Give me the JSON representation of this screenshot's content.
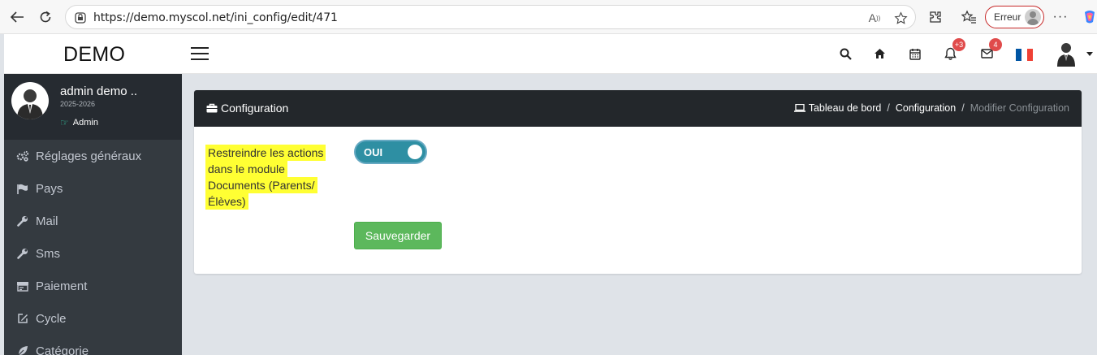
{
  "browser": {
    "url": "https://demo.myscol.net/ini_config/edit/471",
    "error_label": "Erreur",
    "read_aloud_label": "A"
  },
  "header": {
    "brand": "DEMO",
    "notifications_badge": "+3",
    "messages_badge": "4",
    "flag_colors": [
      "#0055a4",
      "#ffffff",
      "#ef4135"
    ]
  },
  "sidebar": {
    "user_name": "admin demo ..",
    "year": "2025-2026",
    "role": "Admin",
    "items": [
      {
        "label": "Réglages généraux",
        "icon": "cogs-icon"
      },
      {
        "label": "Pays",
        "icon": "flag-icon"
      },
      {
        "label": "Mail",
        "icon": "wrench-icon"
      },
      {
        "label": "Sms",
        "icon": "wrench-icon"
      },
      {
        "label": "Paiement",
        "icon": "payment-icon"
      },
      {
        "label": "Cycle",
        "icon": "edit-icon"
      },
      {
        "label": "Catégorie",
        "icon": "leaf-icon"
      }
    ]
  },
  "content": {
    "title": "Configuration",
    "breadcrumb": {
      "home": "Tableau de bord",
      "section": "Configuration",
      "current": "Modifier Configuration"
    },
    "field_label_lines": [
      "Restreindre les actions",
      "dans le module",
      "Documents (Parents/",
      "Élèves)"
    ],
    "toggle_state": "OUI",
    "save_label": "Sauvegarder"
  },
  "colors": {
    "highlight": "#ffff33",
    "toggle_on": "#2e8fa3",
    "save_button": "#5cb85c",
    "badge": "#e04b4b"
  }
}
